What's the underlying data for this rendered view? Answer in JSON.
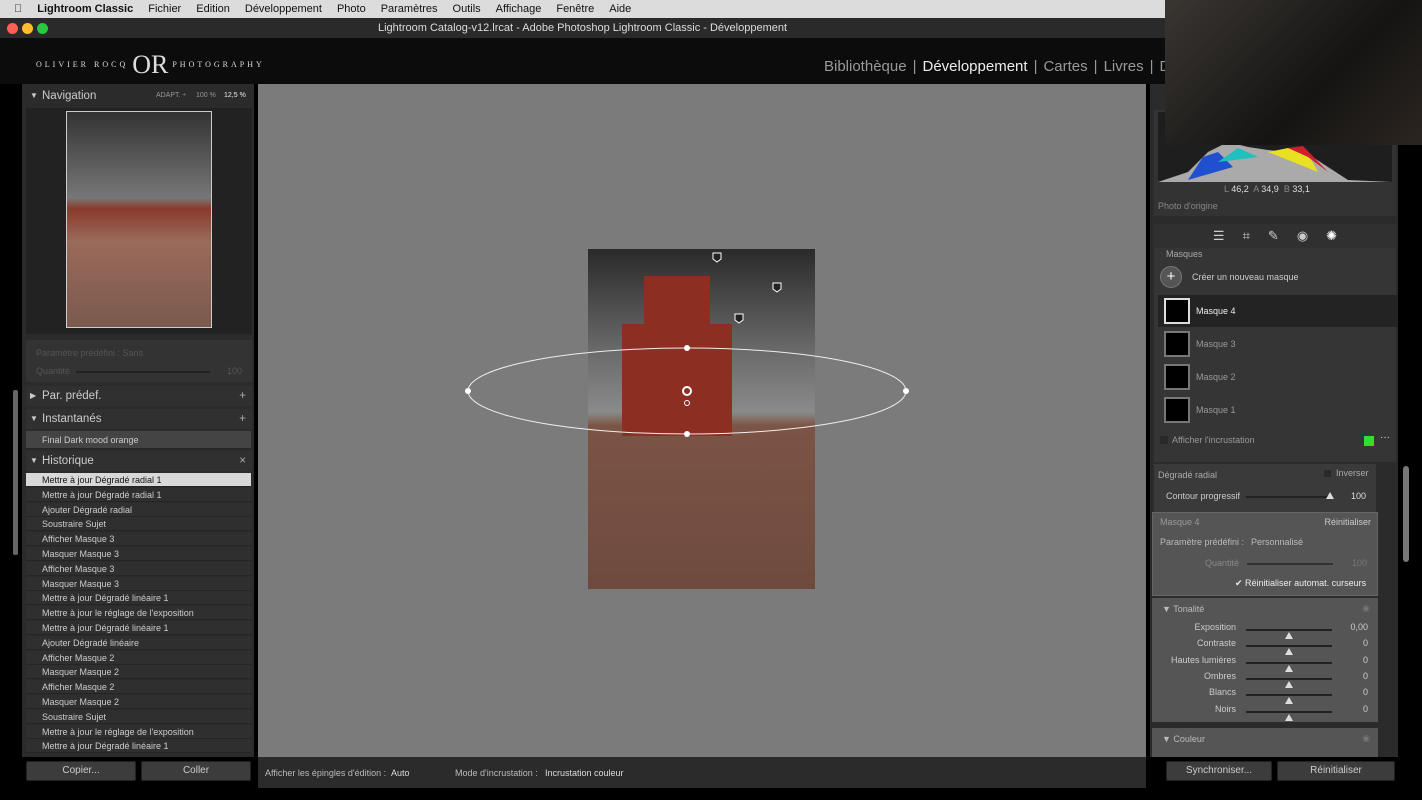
{
  "menubar": {
    "app": "Lightroom Classic",
    "items": [
      "Fichier",
      "Edition",
      "Développement",
      "Photo",
      "Paramètres",
      "Outils",
      "Affichage",
      "Fenêtre",
      "Aide"
    ]
  },
  "window": {
    "title": "Lightroom Catalog-v12.lrcat - Adobe Photoshop Lightroom Classic - Développement"
  },
  "identity": {
    "logo": "OLIVIER ROCQ OR PHOTOGRAPHY",
    "modules": [
      "Bibliothèque",
      "Développement",
      "Cartes",
      "Livres",
      "D"
    ],
    "active": "Développement"
  },
  "navigator": {
    "title": "Navigation",
    "zoom_options": [
      "ADAPT. ÷",
      "100 %",
      "12,5 %"
    ],
    "preset_label": "Paramètre prédéfini : Sans",
    "amount_label": "Quantité",
    "amount_value": "100"
  },
  "presets": {
    "title": "Par. prédef.",
    "add": "+"
  },
  "snapshots": {
    "title": "Instantanés",
    "add": "+",
    "items": [
      "Final Dark mood orange"
    ]
  },
  "history": {
    "title": "Historique",
    "close": "×",
    "items": [
      "Mettre à jour Dégradé radial 1",
      "Mettre à jour Dégradé radial 1",
      "Ajouter Dégradé radial",
      "Soustraire Sujet",
      "Afficher Masque 3",
      "Masquer Masque 3",
      "Afficher Masque 3",
      "Masquer Masque 3",
      "Mettre à jour Dégradé linéaire 1",
      "Mettre à jour le réglage de l'exposition",
      "Mettre à jour Dégradé linéaire 1",
      "Ajouter Dégradé linéaire",
      "Afficher Masque 2",
      "Masquer Masque 2",
      "Afficher Masque 2",
      "Masquer Masque 2",
      "Soustraire Sujet",
      "Mettre à jour le réglage de l'exposition",
      "Mettre à jour Dégradé linéaire 1"
    ]
  },
  "left_buttons": {
    "copy": "Copier...",
    "paste": "Coller"
  },
  "toolbar": {
    "pins_label": "Afficher les épingles d'édition :",
    "pins_value": "Auto",
    "overlay_label": "Mode d'incrustation :",
    "overlay_value": "Incrustation couleur"
  },
  "histogram": {
    "L_label": "L",
    "L": "46,2",
    "A_label": "A",
    "A": "34,9",
    "B_label": "B",
    "B": "33,1",
    "original": "Photo d'origine"
  },
  "tools": [
    "sliders-icon",
    "crop-icon",
    "healing-icon",
    "redeye-icon",
    "masking-icon"
  ],
  "masks": {
    "title": "Masques",
    "create": "Créer un nouveau masque",
    "items": [
      "Masque 4",
      "Masque 3",
      "Masque 2",
      "Masque 1"
    ],
    "selected": "Masque 4",
    "overlay_label": "Afficher l'incrustation",
    "overlay_color": "#33dd33"
  },
  "radial": {
    "title": "Dégradé radial",
    "invert": "Inverser",
    "feather_label": "Contour progressif",
    "feather_value": "100"
  },
  "mask_settings": {
    "title": "Masque 4",
    "reset": "Réinitialiser",
    "preset_label": "Paramètre prédéfini :",
    "preset_value": "Personnalisé",
    "amount_label": "Quantité",
    "amount_value": "100",
    "auto_reset": "Réinitialiser automat. curseurs"
  },
  "tone": {
    "title": "Tonalité",
    "sliders": [
      {
        "label": "Exposition",
        "value": "0,00"
      },
      {
        "label": "Contraste",
        "value": "0"
      },
      {
        "label": "Hautes lumières",
        "value": "0"
      },
      {
        "label": "Ombres",
        "value": "0"
      },
      {
        "label": "Blancs",
        "value": "0"
      },
      {
        "label": "Noirs",
        "value": "0"
      }
    ]
  },
  "color": {
    "title": "Couleur"
  },
  "right_buttons": {
    "sync": "Synchroniser...",
    "reset": "Réinitialiser"
  }
}
